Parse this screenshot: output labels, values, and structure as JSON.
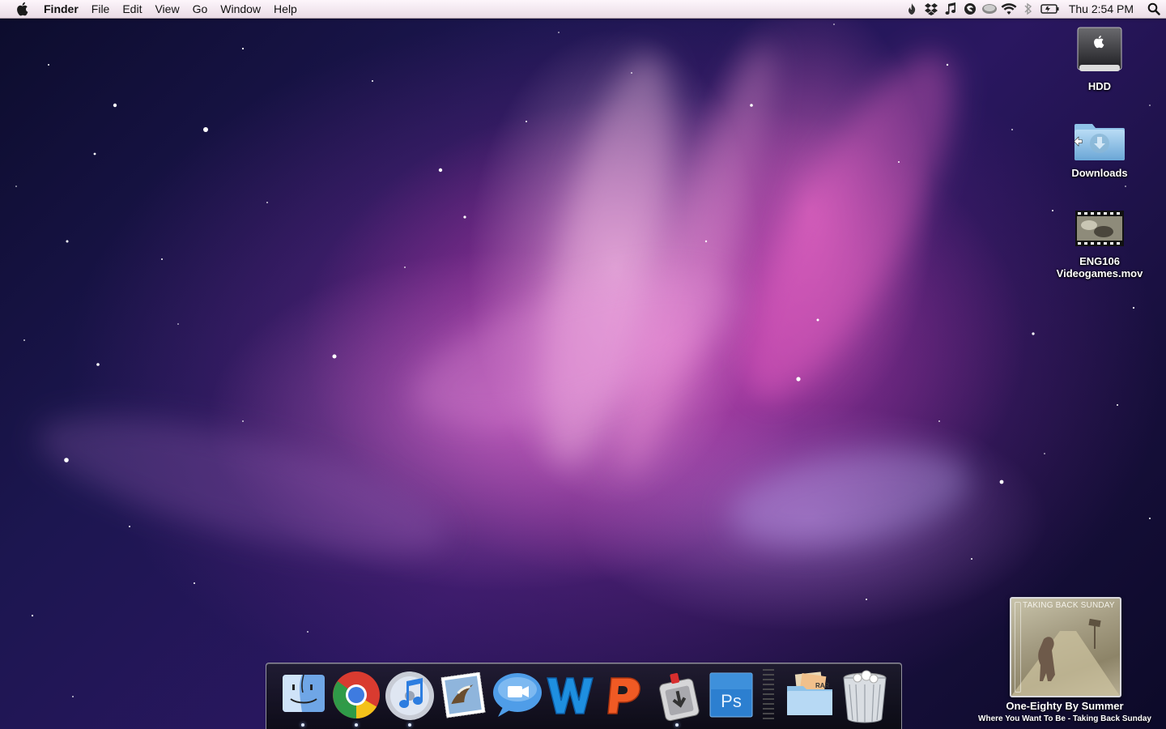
{
  "menubar": {
    "app_name": "Finder",
    "menus": [
      "File",
      "Edit",
      "View",
      "Go",
      "Window",
      "Help"
    ],
    "status_icons": [
      "flame-icon",
      "dropbox-icon",
      "music-note-icon",
      "growl-icon",
      "disk-icon",
      "wifi-icon",
      "bluetooth-icon",
      "battery-icon"
    ],
    "clock": "Thu 2:54 PM"
  },
  "desktop": {
    "icons": [
      {
        "label": "HDD",
        "icon": "hard-drive-icon"
      },
      {
        "label": "Downloads",
        "icon": "downloads-folder-icon"
      },
      {
        "label": "ENG106 Videogames.mov",
        "line1": "ENG106",
        "line2": "Videogames.mov",
        "icon": "movie-file-icon"
      }
    ]
  },
  "dock": {
    "apps": [
      {
        "name": "Finder",
        "icon": "finder-icon",
        "running": true
      },
      {
        "name": "Google Chrome",
        "icon": "chrome-icon",
        "running": true
      },
      {
        "name": "iTunes",
        "icon": "itunes-icon",
        "running": true
      },
      {
        "name": "Mail",
        "icon": "mail-icon",
        "running": false
      },
      {
        "name": "iChat",
        "icon": "ichat-icon",
        "running": false
      },
      {
        "name": "Word",
        "icon": "word-icon",
        "running": false
      },
      {
        "name": "PowerPoint",
        "icon": "powerpoint-icon",
        "running": false
      },
      {
        "name": "Transmission",
        "icon": "transmission-icon",
        "running": true
      },
      {
        "name": "Photoshop",
        "icon": "photoshop-icon",
        "running": false
      },
      {
        "name": "Downloads Stack",
        "icon": "stack-folder-icon",
        "running": false
      },
      {
        "name": "Trash",
        "icon": "trash-icon",
        "running": false
      }
    ]
  },
  "now_playing": {
    "cover_text": "TAKING BACK SUNDAY",
    "title": "One-Eighty By Summer",
    "subtitle": "Where You Want To Be - Taking Back Sunday"
  }
}
